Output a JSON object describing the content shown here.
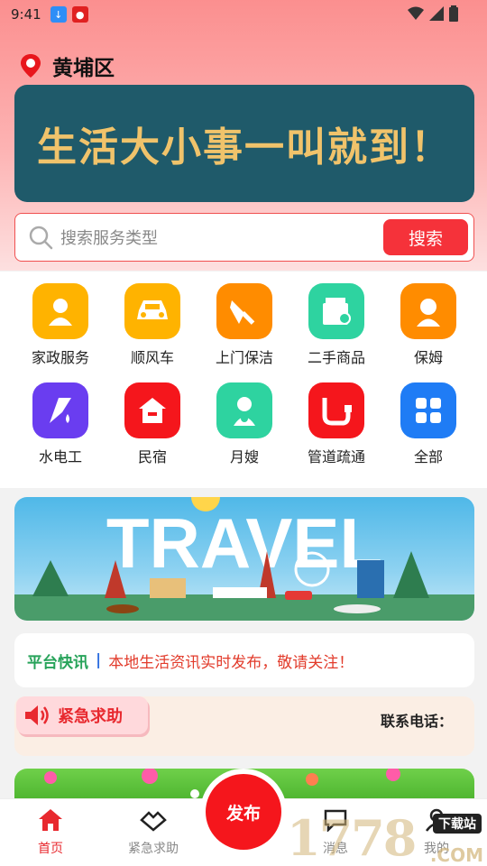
{
  "status_bar": {
    "time": "9:41"
  },
  "location": {
    "city": "黄埔区"
  },
  "slogan": {
    "text": "生活大小事一叫就到！"
  },
  "search": {
    "placeholder": "搜索服务类型",
    "button": "搜索"
  },
  "categories": [
    {
      "label": "家政服务",
      "color": "#ffb300",
      "icon": "housekeeper-icon"
    },
    {
      "label": "顺风车",
      "color": "#ffb300",
      "icon": "car-icon"
    },
    {
      "label": "上门保洁",
      "color": "#ff8c00",
      "icon": "broom-icon"
    },
    {
      "label": "二手商品",
      "color": "#2ed3a0",
      "icon": "box-icon"
    },
    {
      "label": "保姆",
      "color": "#ff8c00",
      "icon": "nanny-icon"
    },
    {
      "label": "水电工",
      "color": "#6a3df0",
      "icon": "plumber-icon"
    },
    {
      "label": "民宿",
      "color": "#f5161c",
      "icon": "house-icon"
    },
    {
      "label": "月嫂",
      "color": "#2ed3a0",
      "icon": "maternity-icon"
    },
    {
      "label": "管道疏通",
      "color": "#f5161c",
      "icon": "pipe-icon"
    },
    {
      "label": "全部",
      "color": "#1f7cf5",
      "icon": "grid-icon"
    }
  ],
  "travel_banner": {
    "text": "TRAVEL"
  },
  "news": {
    "tag": "平台快讯",
    "separator": "|",
    "text": "本地生活资讯实时发布，敬请关注！"
  },
  "emergency": {
    "title": "紧急求助",
    "phone_label": "联系电话："
  },
  "bottom_nav": {
    "home": "首页",
    "help": "紧急求助",
    "publish": "发布",
    "messages": "消息",
    "mine": "我的"
  },
  "watermark": {
    "number": "1778",
    "site": "下载站",
    "domain": ".COM"
  },
  "colors": {
    "accent": "#f5161c",
    "header_pink": "#fb8f8f",
    "slogan_bg": "#1f5a6a",
    "slogan_text": "#f0c36b"
  }
}
